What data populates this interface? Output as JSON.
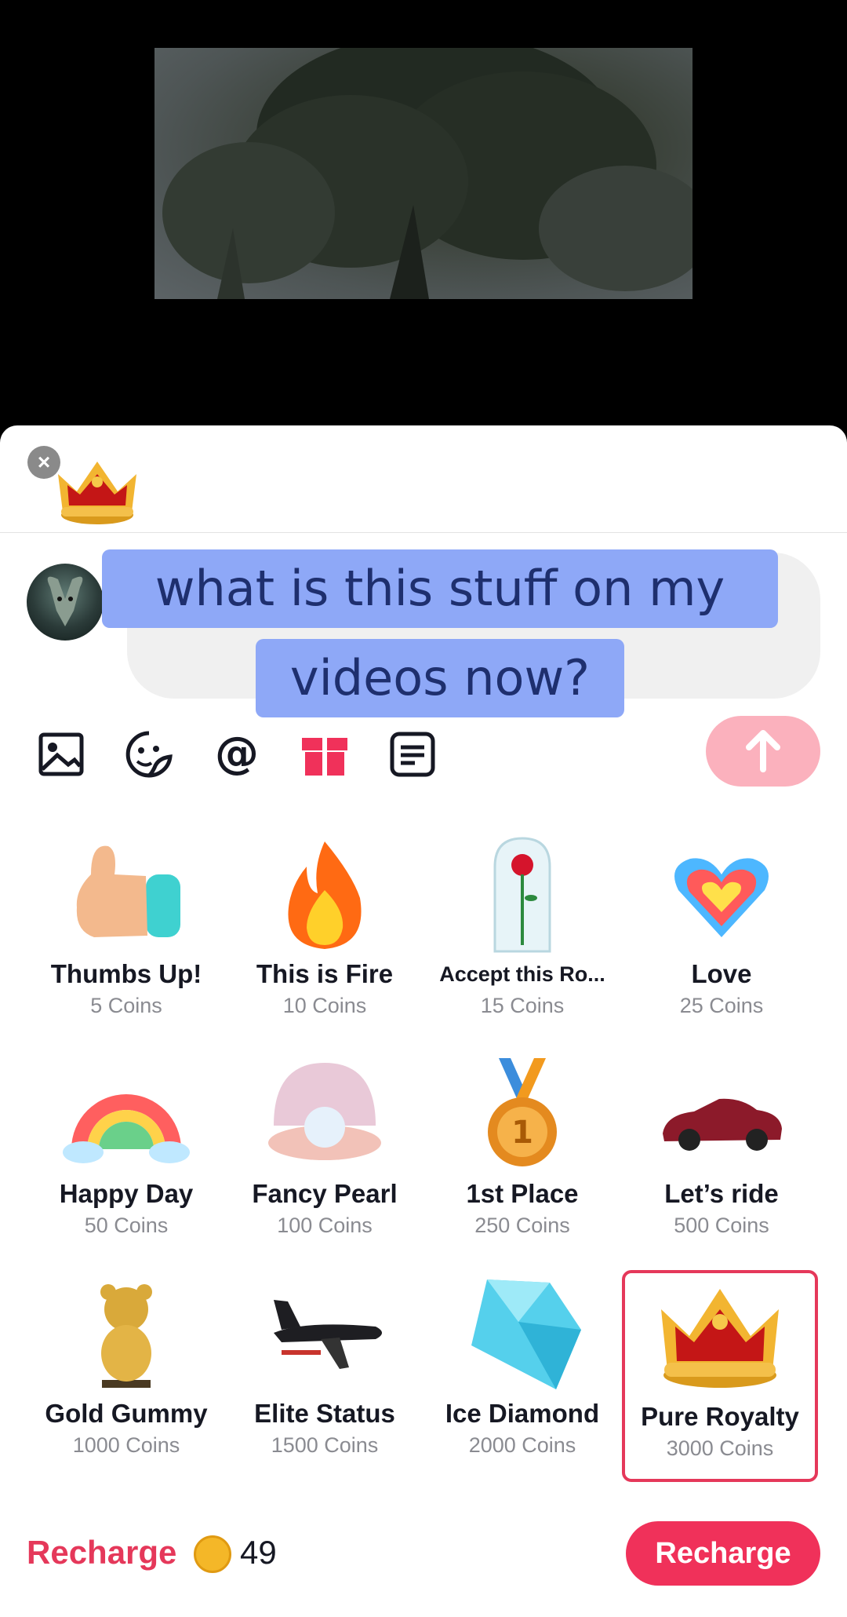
{
  "comment": {
    "line1": "what is this stuff on my",
    "line2": "videos now?"
  },
  "toolbar": {
    "icons": [
      "image-icon",
      "sticker-icon",
      "mention-icon",
      "gift-icon",
      "text-template-icon"
    ],
    "send_icon": "arrow-up-icon"
  },
  "gifts": [
    {
      "name": "Thumbs Up!",
      "price": "5 Coins",
      "icon": "thumbs-up-icon"
    },
    {
      "name": "This is Fire",
      "price": "10 Coins",
      "icon": "fire-icon"
    },
    {
      "name": "Accept this Ro...",
      "price": "15 Coins",
      "icon": "rose-dome-icon"
    },
    {
      "name": "Love",
      "price": "25 Coins",
      "icon": "heart-icon"
    },
    {
      "name": "Happy Day",
      "price": "50 Coins",
      "icon": "rainbow-icon"
    },
    {
      "name": "Fancy Pearl",
      "price": "100 Coins",
      "icon": "pearl-shell-icon"
    },
    {
      "name": "1st Place",
      "price": "250 Coins",
      "icon": "medal-icon"
    },
    {
      "name": "Let’s ride",
      "price": "500 Coins",
      "icon": "sports-car-icon"
    },
    {
      "name": "Gold Gummy",
      "price": "1000 Coins",
      "icon": "gold-bear-icon"
    },
    {
      "name": "Elite Status",
      "price": "1500 Coins",
      "icon": "private-jet-icon"
    },
    {
      "name": "Ice Diamond",
      "price": "2000 Coins",
      "icon": "diamond-icon"
    },
    {
      "name": "Pure Royalty",
      "price": "3000 Coins",
      "icon": "crown-icon",
      "selected": true
    }
  ],
  "footer": {
    "recharge_link": "Recharge",
    "coin_balance": "49",
    "recharge_button": "Recharge"
  },
  "colors": {
    "accent": "#f0315a",
    "send_disabled": "#fbb1bd",
    "highlight": "#8ea8f7"
  }
}
